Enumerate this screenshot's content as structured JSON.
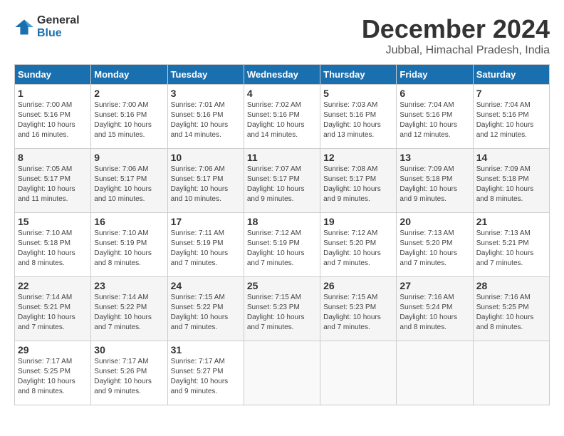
{
  "logo": {
    "line1": "General",
    "line2": "Blue"
  },
  "title": "December 2024",
  "location": "Jubbal, Himachal Pradesh, India",
  "days_of_week": [
    "Sunday",
    "Monday",
    "Tuesday",
    "Wednesday",
    "Thursday",
    "Friday",
    "Saturday"
  ],
  "weeks": [
    [
      {
        "day": "1",
        "info": "Sunrise: 7:00 AM\nSunset: 5:16 PM\nDaylight: 10 hours\nand 16 minutes."
      },
      {
        "day": "2",
        "info": "Sunrise: 7:00 AM\nSunset: 5:16 PM\nDaylight: 10 hours\nand 15 minutes."
      },
      {
        "day": "3",
        "info": "Sunrise: 7:01 AM\nSunset: 5:16 PM\nDaylight: 10 hours\nand 14 minutes."
      },
      {
        "day": "4",
        "info": "Sunrise: 7:02 AM\nSunset: 5:16 PM\nDaylight: 10 hours\nand 14 minutes."
      },
      {
        "day": "5",
        "info": "Sunrise: 7:03 AM\nSunset: 5:16 PM\nDaylight: 10 hours\nand 13 minutes."
      },
      {
        "day": "6",
        "info": "Sunrise: 7:04 AM\nSunset: 5:16 PM\nDaylight: 10 hours\nand 12 minutes."
      },
      {
        "day": "7",
        "info": "Sunrise: 7:04 AM\nSunset: 5:16 PM\nDaylight: 10 hours\nand 12 minutes."
      }
    ],
    [
      {
        "day": "8",
        "info": "Sunrise: 7:05 AM\nSunset: 5:17 PM\nDaylight: 10 hours\nand 11 minutes."
      },
      {
        "day": "9",
        "info": "Sunrise: 7:06 AM\nSunset: 5:17 PM\nDaylight: 10 hours\nand 10 minutes."
      },
      {
        "day": "10",
        "info": "Sunrise: 7:06 AM\nSunset: 5:17 PM\nDaylight: 10 hours\nand 10 minutes."
      },
      {
        "day": "11",
        "info": "Sunrise: 7:07 AM\nSunset: 5:17 PM\nDaylight: 10 hours\nand 9 minutes."
      },
      {
        "day": "12",
        "info": "Sunrise: 7:08 AM\nSunset: 5:17 PM\nDaylight: 10 hours\nand 9 minutes."
      },
      {
        "day": "13",
        "info": "Sunrise: 7:09 AM\nSunset: 5:18 PM\nDaylight: 10 hours\nand 9 minutes."
      },
      {
        "day": "14",
        "info": "Sunrise: 7:09 AM\nSunset: 5:18 PM\nDaylight: 10 hours\nand 8 minutes."
      }
    ],
    [
      {
        "day": "15",
        "info": "Sunrise: 7:10 AM\nSunset: 5:18 PM\nDaylight: 10 hours\nand 8 minutes."
      },
      {
        "day": "16",
        "info": "Sunrise: 7:10 AM\nSunset: 5:19 PM\nDaylight: 10 hours\nand 8 minutes."
      },
      {
        "day": "17",
        "info": "Sunrise: 7:11 AM\nSunset: 5:19 PM\nDaylight: 10 hours\nand 7 minutes."
      },
      {
        "day": "18",
        "info": "Sunrise: 7:12 AM\nSunset: 5:19 PM\nDaylight: 10 hours\nand 7 minutes."
      },
      {
        "day": "19",
        "info": "Sunrise: 7:12 AM\nSunset: 5:20 PM\nDaylight: 10 hours\nand 7 minutes."
      },
      {
        "day": "20",
        "info": "Sunrise: 7:13 AM\nSunset: 5:20 PM\nDaylight: 10 hours\nand 7 minutes."
      },
      {
        "day": "21",
        "info": "Sunrise: 7:13 AM\nSunset: 5:21 PM\nDaylight: 10 hours\nand 7 minutes."
      }
    ],
    [
      {
        "day": "22",
        "info": "Sunrise: 7:14 AM\nSunset: 5:21 PM\nDaylight: 10 hours\nand 7 minutes."
      },
      {
        "day": "23",
        "info": "Sunrise: 7:14 AM\nSunset: 5:22 PM\nDaylight: 10 hours\nand 7 minutes."
      },
      {
        "day": "24",
        "info": "Sunrise: 7:15 AM\nSunset: 5:22 PM\nDaylight: 10 hours\nand 7 minutes."
      },
      {
        "day": "25",
        "info": "Sunrise: 7:15 AM\nSunset: 5:23 PM\nDaylight: 10 hours\nand 7 minutes."
      },
      {
        "day": "26",
        "info": "Sunrise: 7:15 AM\nSunset: 5:23 PM\nDaylight: 10 hours\nand 7 minutes."
      },
      {
        "day": "27",
        "info": "Sunrise: 7:16 AM\nSunset: 5:24 PM\nDaylight: 10 hours\nand 8 minutes."
      },
      {
        "day": "28",
        "info": "Sunrise: 7:16 AM\nSunset: 5:25 PM\nDaylight: 10 hours\nand 8 minutes."
      }
    ],
    [
      {
        "day": "29",
        "info": "Sunrise: 7:17 AM\nSunset: 5:25 PM\nDaylight: 10 hours\nand 8 minutes."
      },
      {
        "day": "30",
        "info": "Sunrise: 7:17 AM\nSunset: 5:26 PM\nDaylight: 10 hours\nand 9 minutes."
      },
      {
        "day": "31",
        "info": "Sunrise: 7:17 AM\nSunset: 5:27 PM\nDaylight: 10 hours\nand 9 minutes."
      },
      {
        "day": "",
        "info": ""
      },
      {
        "day": "",
        "info": ""
      },
      {
        "day": "",
        "info": ""
      },
      {
        "day": "",
        "info": ""
      }
    ]
  ]
}
